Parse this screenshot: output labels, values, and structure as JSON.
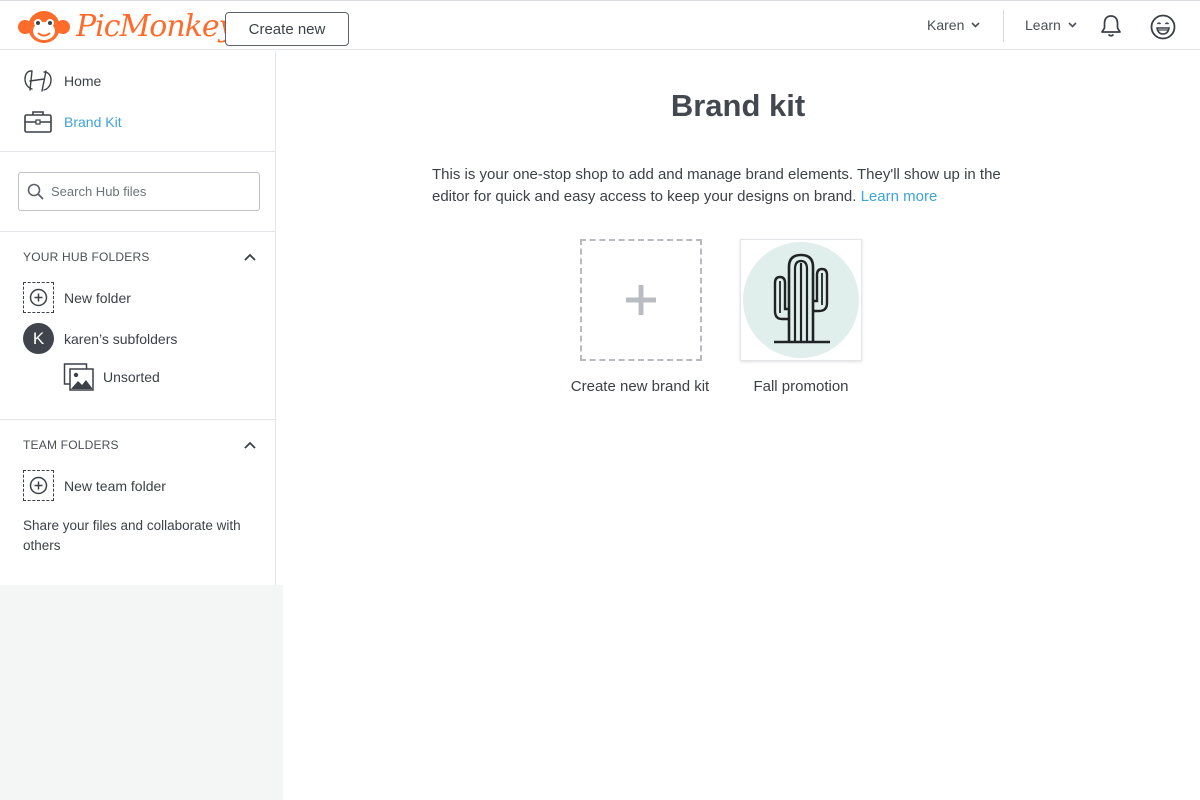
{
  "header": {
    "logo_text": "PicMonkey",
    "create_new_label": "Create new",
    "user_name": "Karen",
    "learn_label": "Learn"
  },
  "sidebar": {
    "nav": [
      {
        "label": "Home",
        "icon": "home-h-icon"
      },
      {
        "label": "Brand Kit",
        "icon": "briefcase-icon",
        "active": true
      }
    ],
    "search": {
      "placeholder": "Search Hub files"
    },
    "hub_folders": {
      "heading": "YOUR HUB FOLDERS",
      "new_folder_label": "New folder",
      "user_folder": {
        "avatar_letter": "K",
        "label": "karen’s subfolders"
      },
      "unsorted_label": "Unsorted"
    },
    "team_folders": {
      "heading": "TEAM FOLDERS",
      "new_team_folder_label": "New team folder",
      "share_text": "Share your files and collaborate with others"
    }
  },
  "main": {
    "title": "Brand kit",
    "description": "This is your one-stop shop to add and manage brand elements. They'll show up in the editor for quick and easy access to keep your designs on brand.",
    "learn_more": "Learn more",
    "cards": [
      {
        "label": "Create new brand kit",
        "icon": "plus-icon"
      },
      {
        "label": "Fall promotion",
        "icon": "cactus-icon"
      }
    ]
  },
  "colors": {
    "brand_orange": "#ff6b2b",
    "link_blue": "#3fa3d9",
    "text_dark": "#3c4148",
    "cactus_bg": "#e1efec"
  }
}
